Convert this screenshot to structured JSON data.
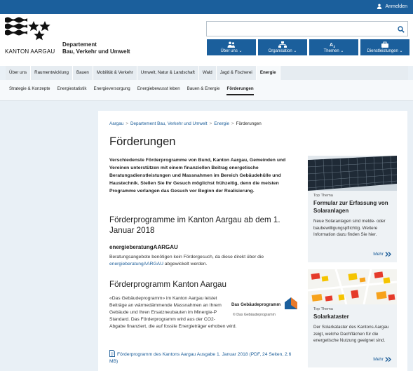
{
  "topbar": {
    "login_label": "Anmelden"
  },
  "logo": {
    "text": "KANTON AARGAU"
  },
  "department": {
    "line1": "Departement",
    "line2": "Bau, Verkehr und Umwelt"
  },
  "search": {
    "placeholder": "",
    "icon": "search-icon"
  },
  "quicknav": [
    {
      "label": "Über uns",
      "icon": "people-icon"
    },
    {
      "label": "Organisation",
      "icon": "org-chart-icon"
    },
    {
      "label": "Themen",
      "icon": "az-icon"
    },
    {
      "label": "Dienstleistungen",
      "icon": "service-icon"
    }
  ],
  "mainnav": [
    "Über uns",
    "Raumentwicklung",
    "Bauen",
    "Mobilität & Verkehr",
    "Umwelt, Natur & Landschaft",
    "Wald",
    "Jagd & Fischerei",
    "Energie"
  ],
  "subnav": [
    "Strategie & Konzepte",
    "Energiestatistik",
    "Energieversorgung",
    "Energiebewusst leben",
    "Bauen & Energie",
    "Förderungen"
  ],
  "breadcrumb": [
    "Aargau",
    "Departement Bau, Verkehr und Umwelt",
    "Energie",
    "Förderungen"
  ],
  "page": {
    "title": "Förderungen",
    "intro": "Verschiedenste Förderprogramme von Bund, Kanton Aargau, Gemeinden und Vereinen unterstützen mit einem finanziellen Beitrag energetische Beratungsdienstleistungen und Massnahmen im Bereich Gebäudehülle und Haustechnik. Stellen Sie Ihr Gesuch möglichst frühzeitig, denn die meisten Programme verlangen das Gesuch vor Beginn der Realisierung.",
    "section1_title": "Förderprogramme im Kanton Aargau ab dem 1. Januar 2018",
    "section1_sub": "energieberatungAARGAU",
    "p1_text": "Beratungsangebote benötigen kein Fördergesuch, da diese direkt über die ",
    "p1_link": "energieberatungAARGAU",
    "p1_end": " abgewickelt werden.",
    "section2_title": "Förderprogramm Kanton Aargau",
    "p2_text": "«Das Gebäudeprogramm» im Kanton Aargau leistet Beiträge an wärmedämmende Massnahmen an Ihrem Gebäude und Ihren Ersatzneubauten im Minergie-P Standard. Das Förderprogramm wird aus der CO2-Abgabe finanziert, die auf fossile Energieträger erhoben wird.",
    "gp_logo_text": "Das Gebäudeprogramm",
    "gp_logo_sub": "© Das Gebäudeprogramm",
    "pdf_link": "Förderprogramm des Kantons Aargau Ausgabe 1. Januar 2018 (PDF, 24 Seiten, 2.6 MB)"
  },
  "teasers": [
    {
      "tag": "Top Thema",
      "title": "Formular zur Erfassung von Solaranlagen",
      "body": "Neue Solaranlagen sind melde- oder baubewilligungspflichtig. Weitere Information dazu finden Sie hier.",
      "more": "Mehr"
    },
    {
      "tag": "Top Thema",
      "title": "Solarkataster",
      "body": "Der Solarkataster des Kantons Aargau zeigt, welche Dachflächen für die energetische Nutzung geeignet sind.",
      "more": "Mehr"
    }
  ]
}
